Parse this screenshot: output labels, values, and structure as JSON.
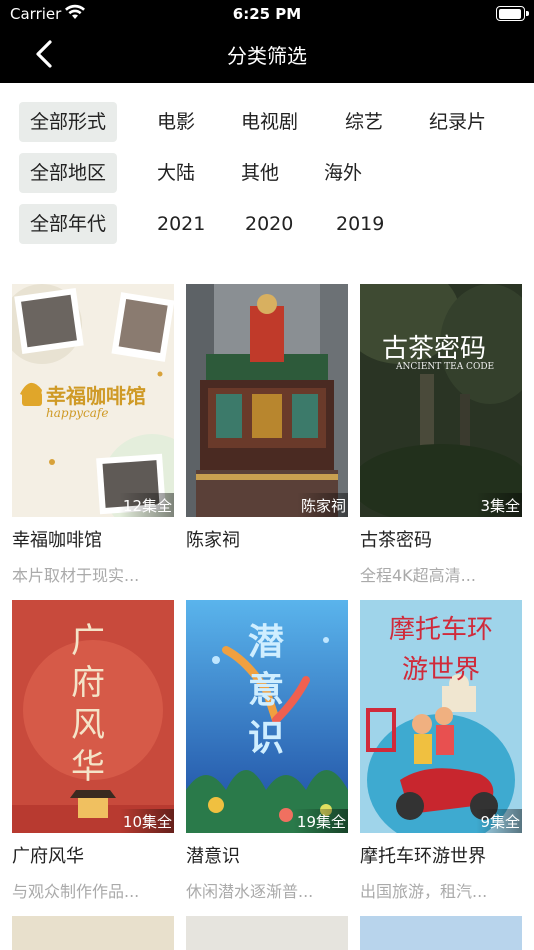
{
  "status_bar": {
    "carrier": "Carrier",
    "time": "6:25 PM",
    "battery_level": 0.95
  },
  "nav": {
    "title": "分类筛选",
    "back_icon": "chevron-left-icon"
  },
  "filters": {
    "form": [
      "全部形式",
      "电影",
      "电视剧",
      "综艺",
      "纪录片"
    ],
    "region": [
      "全部地区",
      "大陆",
      "其他",
      "海外"
    ],
    "year": [
      "全部年代",
      "2021",
      "2020",
      "2019"
    ]
  },
  "items": [
    {
      "title": "幸福咖啡馆",
      "desc": "本片取材于现实...",
      "badge": "12集全",
      "poster_text": "幸福咖啡馆",
      "poster_sub": "happycafe"
    },
    {
      "title": "陈家祠",
      "desc": "",
      "badge": "陈家祠"
    },
    {
      "title": "古茶密码",
      "desc": "全程4K超高清...",
      "badge": "3集全",
      "poster_text": "古茶密码",
      "poster_sub": "ANCIENT TEA CODE"
    },
    {
      "title": "广府风华",
      "desc": "与观众制作作品...",
      "badge": "10集全",
      "poster_text": "广府风华"
    },
    {
      "title": "潜意识",
      "desc": "休闲潜水逐渐普...",
      "badge": "19集全",
      "poster_text": "潜意识"
    },
    {
      "title": "摩托车环游世界",
      "desc": "出国旅游，租汽...",
      "badge": "9集全",
      "poster_text": "摩托车环游世界"
    }
  ],
  "colors": {
    "nav_bg": "#000000",
    "chip_selected_bg": "#e9ecea",
    "desc_text": "#aaaaaa"
  }
}
